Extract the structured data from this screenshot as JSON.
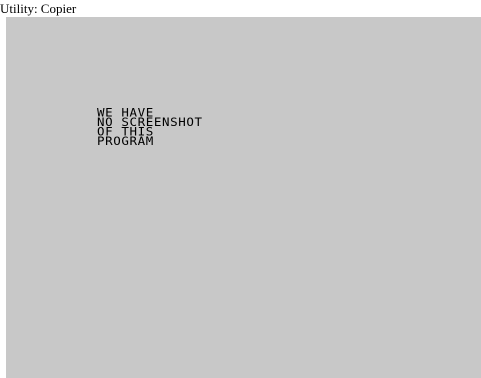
{
  "caption": {
    "text": "Utility: Copier"
  },
  "screen": {
    "background_color": "#c8c8c8",
    "text_color": "#000000",
    "lines": [
      "WE HAVE",
      "NO SCREENSHOT",
      "OF THIS",
      "PROGRAM"
    ]
  }
}
